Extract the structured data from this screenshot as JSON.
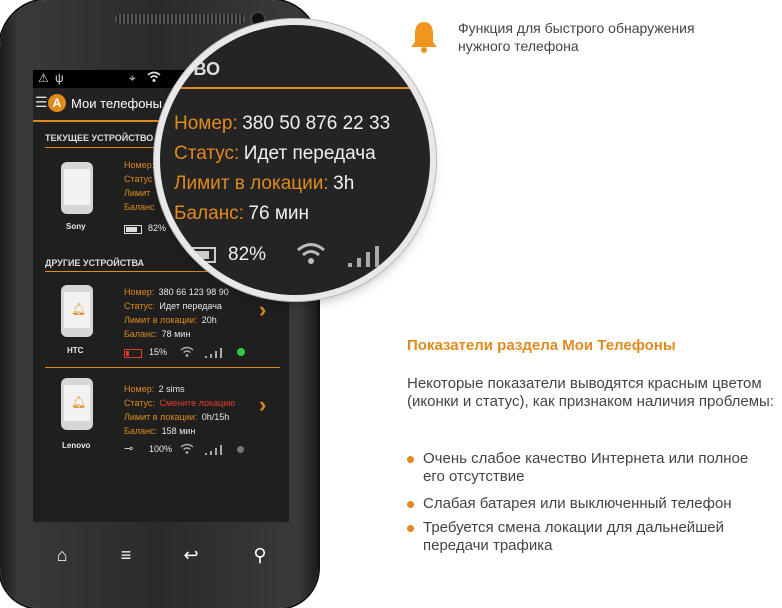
{
  "feature": {
    "text": "Функция для быстрого обнаружения нужного телефона",
    "icon": "bell-icon"
  },
  "status_bar": {
    "icons": [
      "warning-icon",
      "usb-icon",
      "gps-icon",
      "wifi-icon"
    ]
  },
  "app": {
    "title": "Мои телефоны",
    "icon": "app-logo-icon"
  },
  "current_section": "ТЕКУЩЕЕ УСТРОЙСТВО",
  "other_section": "ДРУГИЕ УСТРОЙСТВА",
  "labels": {
    "number": "Номер:",
    "status": "Статус:",
    "limit": "Лимит в локации:",
    "balance": "Баланс:"
  },
  "short_labels": {
    "status": "Статус",
    "limit": "Лимит",
    "balance": "Баланс"
  },
  "current_device": {
    "name": "Sony",
    "battery": "82%"
  },
  "devices": [
    {
      "name": "HTC",
      "number": "380 66 123 98 90",
      "status": "Идет передача",
      "limit": "20h",
      "balance": "78 мин",
      "battery": "15%",
      "battery_state": "low",
      "online": true,
      "accent": "#e03c2a"
    },
    {
      "name": "Lenovo",
      "number": "2 sims",
      "status": "Смените локацию",
      "limit": "0h/15h",
      "balance": "158 мин",
      "battery": "100%",
      "battery_state": "charging",
      "online": false,
      "accent": "#e03c2a"
    }
  ],
  "magnifier": {
    "header": "СТВО",
    "number": "380 50 876 22 33",
    "status": "Идет передача",
    "limit": "3h",
    "balance": "76 мин",
    "battery": "82%"
  },
  "nav": {
    "home": "⌂",
    "menu": "≡",
    "back": "↩",
    "search": "⚲"
  },
  "info": {
    "heading": "Показатели раздела Мои Телефоны",
    "paragraph": "Некоторые показатели выводятся красным цветом (иконки и статус), как признаком наличия проблемы:",
    "bullets": [
      "Очень слабое качество Интернета или полное его отсутствие",
      "Слабая батарея или выключенный телефон",
      "Требуется смена локации для дальнейшей передачи трафика"
    ]
  },
  "colors": {
    "accent": "#e08a1e",
    "danger": "#e03c2a",
    "ok": "#2ecc40"
  }
}
